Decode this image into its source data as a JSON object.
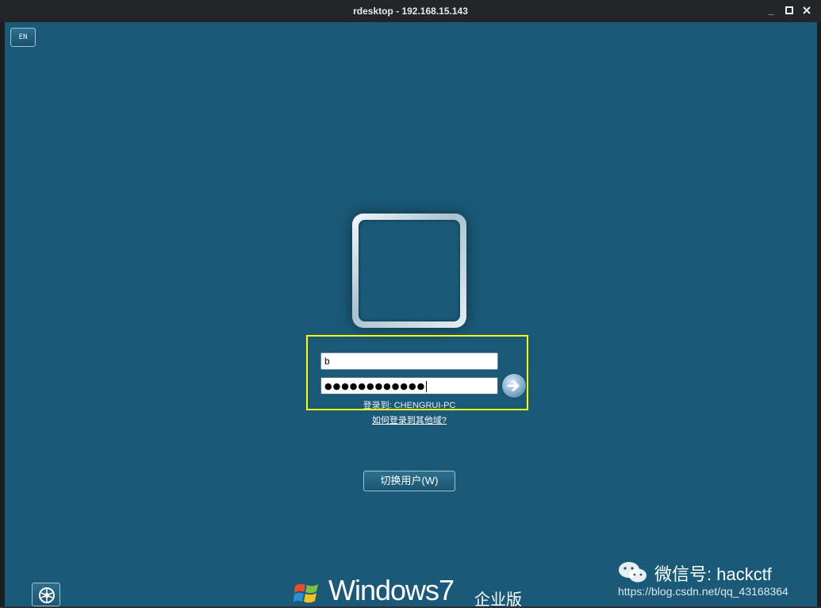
{
  "window": {
    "title": "rdesktop - 192.168.15.143",
    "minimize_glyph": "_",
    "maximize_glyph": "□",
    "close_glyph": "×"
  },
  "language": {
    "label": "EN"
  },
  "login": {
    "username_value": "b",
    "password_mask": "●●●●●●●●●●●●",
    "logon_to": "登录到: CHENGRUI-PC",
    "domain_help_link": "如何登录到其他域?",
    "submit_icon": "arrow-right-icon"
  },
  "switch_user": {
    "label": "切换用户(W)"
  },
  "ease_of_access": {
    "icon": "ease-of-access-icon"
  },
  "branding": {
    "wordmark": "Windows",
    "version": "7",
    "edition": "企业版"
  },
  "watermark": {
    "wechat": "微信号: hackctf",
    "url": "https://blog.csdn.net/qq_43168364"
  },
  "colors": {
    "desktop_background": "#1a5a78",
    "highlight_border": "#ffff00",
    "titlebar": "#232629"
  }
}
